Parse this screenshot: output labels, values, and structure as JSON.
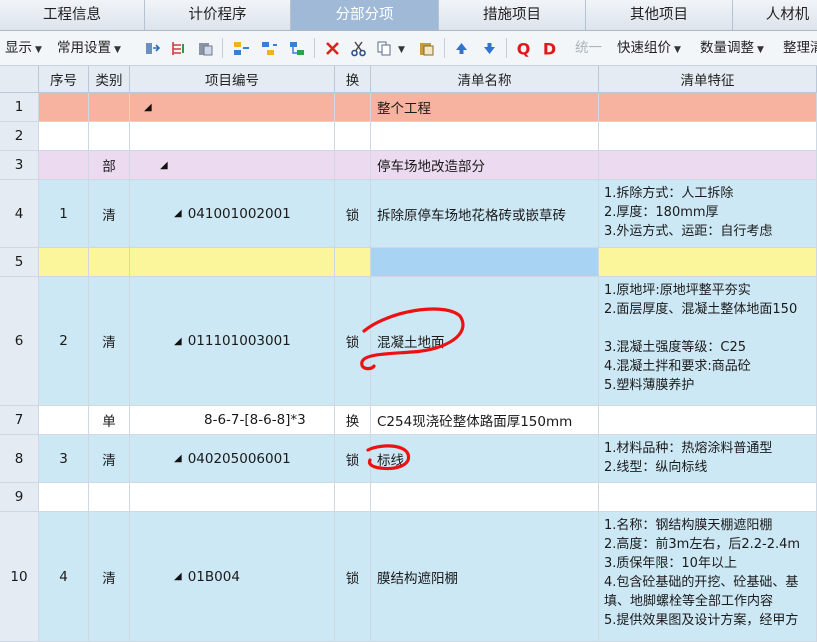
{
  "tabs": [
    {
      "label": "工程信息",
      "active": false
    },
    {
      "label": "计价程序",
      "active": false
    },
    {
      "label": "分部分项",
      "active": true
    },
    {
      "label": "措施项目",
      "active": false
    },
    {
      "label": "其他项目",
      "active": false
    },
    {
      "label": "人材机",
      "active": false
    }
  ],
  "toolbar": {
    "display_label": "显示",
    "common_settings_label": "常用设置",
    "unify_label": "统一",
    "quick_pricing_label": "快速组价",
    "quantity_adjust_label": "数量调整",
    "organize_label": "整理清"
  },
  "colors": {
    "project_row": "#f7b2a0",
    "division_row": "#ecdaf0",
    "item_row": "#cde8f5",
    "yellow_row": "#fbf69c",
    "selected_cell": "#a8d3f2",
    "annotation": "#ee1111"
  },
  "columns": [
    "序号",
    "类别",
    "项目编号",
    "换",
    "清单名称",
    "清单特征"
  ],
  "rows": [
    {
      "no": "1",
      "seq": "",
      "type": "",
      "code": "",
      "tri": true,
      "swap": "",
      "name": "整个工程",
      "features": []
    },
    {
      "no": "2",
      "seq": "",
      "type": "",
      "code": "",
      "tri": false,
      "swap": "",
      "name": "",
      "features": []
    },
    {
      "no": "3",
      "seq": "",
      "type": "部",
      "code": "",
      "tri": true,
      "swap": "",
      "name": "停车场地改造部分",
      "features": []
    },
    {
      "no": "4",
      "seq": "1",
      "type": "清",
      "code": "041001002001",
      "tri": true,
      "swap": "锁",
      "name": "拆除原停车场地花格砖或嵌草砖",
      "features": [
        "1.拆除方式：人工拆除",
        "2.厚度：180mm厚",
        "3.外运方式、运距：自行考虑"
      ]
    },
    {
      "no": "5",
      "seq": "",
      "type": "",
      "code": "",
      "tri": false,
      "swap": "",
      "name": "",
      "features": []
    },
    {
      "no": "6",
      "seq": "2",
      "type": "清",
      "code": "011101003001",
      "tri": true,
      "swap": "锁",
      "name": "混凝土地面",
      "features": [
        "1.原地坪:原地坪整平夯实",
        "2.面层厚度、混凝土整体地面150",
        "",
        "3.混凝土强度等级：C25",
        "4.混凝土拌和要求:商品砼",
        "5.塑料薄膜养护"
      ]
    },
    {
      "no": "7",
      "seq": "",
      "type": "单",
      "code": "8-6-7-[8-6-8]*3",
      "tri": false,
      "swap": "换",
      "name": "C254现浇砼整体路面厚150mm",
      "features": []
    },
    {
      "no": "8",
      "seq": "3",
      "type": "清",
      "code": "040205006001",
      "tri": true,
      "swap": "锁",
      "name": "标线",
      "features": [
        "1.材料品种：热熔涂料普通型",
        "2.线型：纵向标线"
      ]
    },
    {
      "no": "9",
      "seq": "",
      "type": "",
      "code": "",
      "tri": false,
      "swap": "",
      "name": "",
      "features": []
    },
    {
      "no": "10",
      "seq": "4",
      "type": "清",
      "code": "01B004",
      "tri": true,
      "swap": "锁",
      "name": "膜结构遮阳棚",
      "features": [
        "1.名称：钢结构膜天棚遮阳棚",
        "2.高度：前3m左右，后2.2-2.4m",
        "3.质保年限：10年以上",
        "4.包含砼基础的开挖、砼基础、基",
        "填、地脚螺栓等全部工作内容",
        "5.提供效果图及设计方案，经甲方"
      ]
    }
  ]
}
